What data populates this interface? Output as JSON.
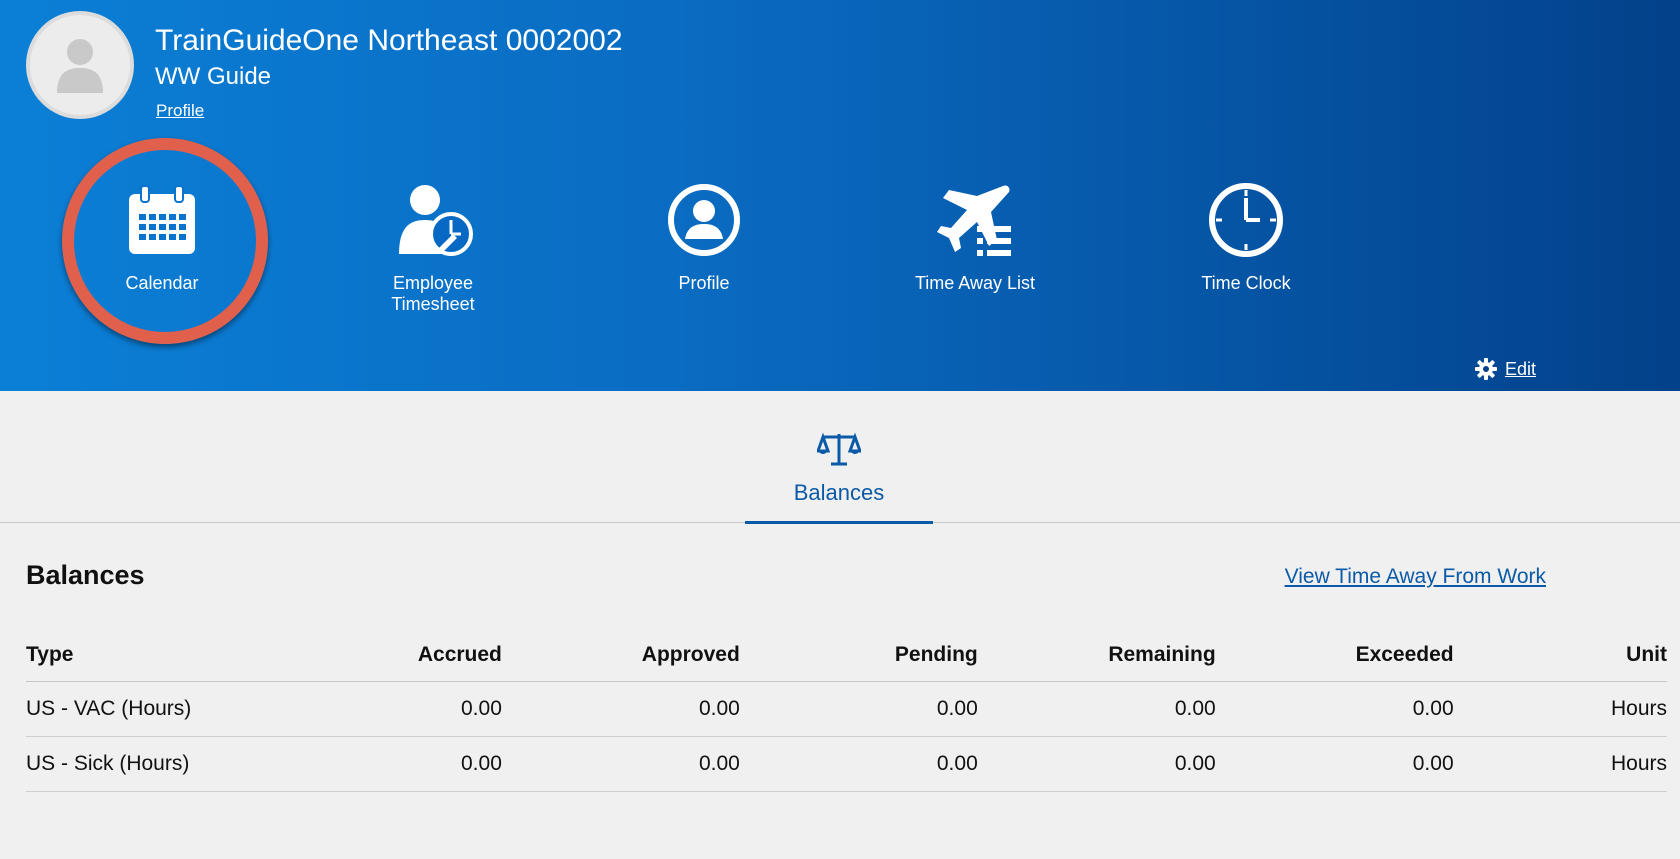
{
  "user": {
    "name": "TrainGuideOne Northeast 0002002",
    "role": "WW Guide",
    "profile_link": "Profile"
  },
  "tiles": [
    {
      "label": "Calendar",
      "icon": "calendar-icon"
    },
    {
      "label": "Employee Timesheet",
      "icon": "employee-timesheet-icon"
    },
    {
      "label": "Profile",
      "icon": "user-circle-icon"
    },
    {
      "label": "Time Away List",
      "icon": "airplane-list-icon"
    },
    {
      "label": "Time Clock",
      "icon": "clock-icon"
    }
  ],
  "edit_label": "Edit",
  "tab": {
    "label": "Balances",
    "icon": "scales-icon"
  },
  "section": {
    "title": "Balances",
    "view_link": "View Time Away From Work"
  },
  "table": {
    "headers": [
      "Type",
      "Accrued",
      "Approved",
      "Pending",
      "Remaining",
      "Exceeded",
      "Unit"
    ],
    "rows": [
      [
        "US - VAC (Hours)",
        "0.00",
        "0.00",
        "0.00",
        "0.00",
        "0.00",
        "Hours"
      ],
      [
        "US - Sick (Hours)",
        "0.00",
        "0.00",
        "0.00",
        "0.00",
        "0.00",
        "Hours"
      ]
    ]
  },
  "colors": {
    "header_start": "#0b7fd6",
    "header_end": "#03418a",
    "highlight_ring": "#e1604b",
    "link_blue": "#0a5aa8"
  }
}
